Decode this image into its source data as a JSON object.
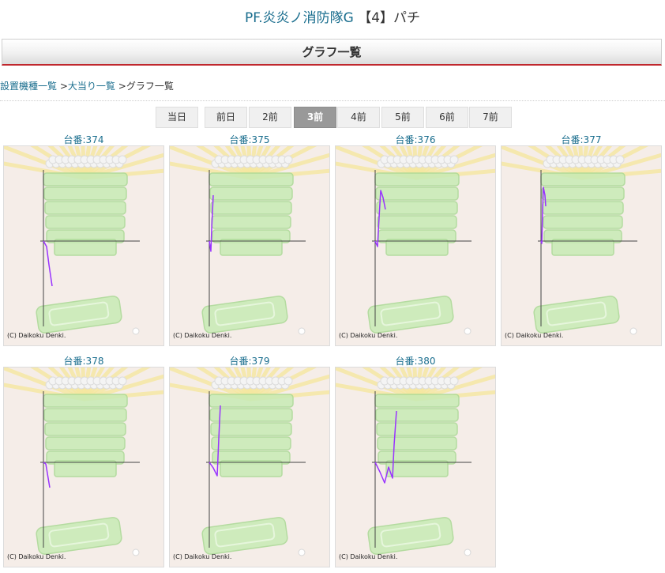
{
  "header": {
    "machine_name": "PF.炎炎ノ消防隊G",
    "machine_suffix": "【4】パチ"
  },
  "section_title": "グラフ一覧",
  "breadcrumb": {
    "link1": "設置機種一覧",
    "sep1": ">",
    "link2": "大当り一覧",
    "sep2": ">",
    "current": "グラフ一覧"
  },
  "day_tabs": [
    {
      "label": "当日",
      "active": false
    },
    {
      "label": "前日",
      "active": false
    },
    {
      "label": "2前",
      "active": false
    },
    {
      "label": "3前",
      "active": true
    },
    {
      "label": "4前",
      "active": false
    },
    {
      "label": "5前",
      "active": false
    },
    {
      "label": "6前",
      "active": false
    },
    {
      "label": "7前",
      "active": false
    }
  ],
  "units": [
    {
      "label": "台番:374",
      "copyright": "(C) Daikoku Denki."
    },
    {
      "label": "台番:375",
      "copyright": "(C) Daikoku Denki."
    },
    {
      "label": "台番:376",
      "copyright": "(C) Daikoku Denki."
    },
    {
      "label": "台番:377",
      "copyright": "(C) Daikoku Denki."
    },
    {
      "label": "台番:378",
      "copyright": "(C) Daikoku Denki."
    },
    {
      "label": "台番:379",
      "copyright": "(C) Daikoku Denki."
    },
    {
      "label": "台番:380",
      "copyright": "(C) Daikoku Denki."
    }
  ],
  "colors": {
    "accent_link": "#1a6e8e",
    "header_rule": "#c0272d",
    "graph_line": "#9933ff",
    "active_tab": "#999999"
  }
}
